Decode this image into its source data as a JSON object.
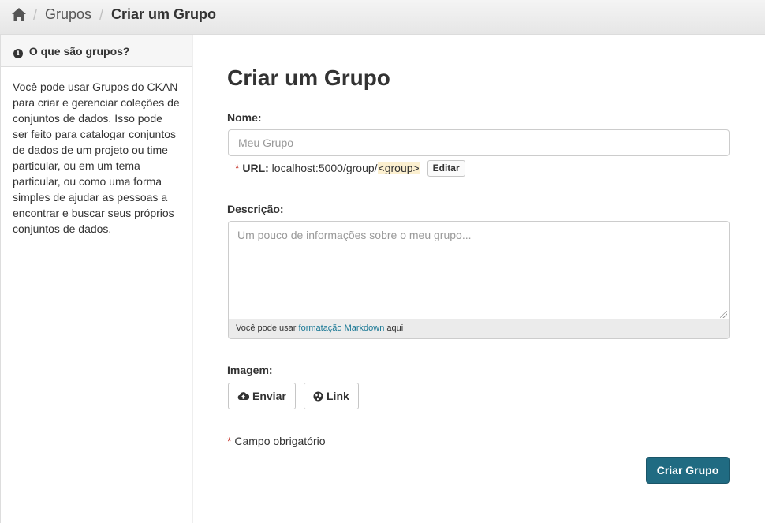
{
  "breadcrumb": {
    "home_icon": "home-icon",
    "separator": "/",
    "items": [
      "Grupos",
      "Criar um Grupo"
    ]
  },
  "sidebar": {
    "heading": "O que são grupos?",
    "info_icon": "info-icon",
    "text": "Você pode usar Grupos do CKAN para criar e gerenciar coleções de conjuntos de dados. Isso pode ser feito para catalogar conjuntos de dados de um projeto ou time particular, ou em um tema particular, ou como uma forma simples de ajudar as pessoas a encontrar e buscar seus próprios conjuntos de dados."
  },
  "main": {
    "title": "Criar um Grupo",
    "name_label": "Nome:",
    "name_placeholder": "Meu Grupo",
    "url": {
      "required_mark": "*",
      "label": "URL:",
      "prefix": "localhost:5000/group/",
      "slug": "<group>",
      "edit_label": "Editar"
    },
    "description_label": "Descrição:",
    "description_placeholder": "Um pouco de informações sobre o meu grupo...",
    "markdown_help": {
      "before": "Você pode usar ",
      "link": "formatação Markdown",
      "after": " aqui"
    },
    "image_label": "Imagem:",
    "upload_label": "Enviar",
    "upload_icon": "cloud-upload-icon",
    "link_label": "Link",
    "link_icon": "globe-icon",
    "required_note": {
      "mark": "*",
      "text": "Campo obrigatório"
    },
    "submit_label": "Criar Grupo"
  },
  "colors": {
    "primary": "#206b82",
    "link": "#187794",
    "required": "#c6342a",
    "slug_highlight": "#fcf0d0"
  }
}
